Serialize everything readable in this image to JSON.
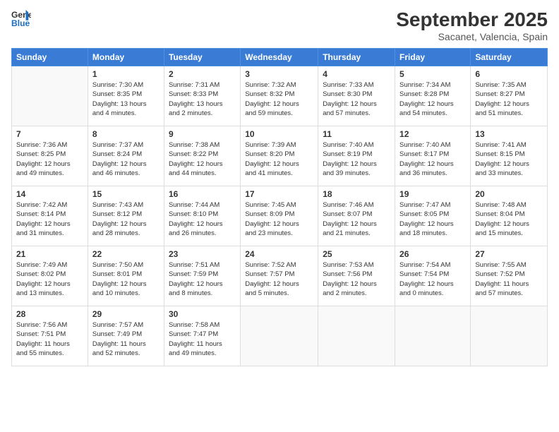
{
  "header": {
    "logo_line1": "General",
    "logo_line2": "Blue",
    "month": "September 2025",
    "location": "Sacanet, Valencia, Spain"
  },
  "days_of_week": [
    "Sunday",
    "Monday",
    "Tuesday",
    "Wednesday",
    "Thursday",
    "Friday",
    "Saturday"
  ],
  "weeks": [
    [
      {
        "num": "",
        "info": ""
      },
      {
        "num": "1",
        "info": "Sunrise: 7:30 AM\nSunset: 8:35 PM\nDaylight: 13 hours\nand 4 minutes."
      },
      {
        "num": "2",
        "info": "Sunrise: 7:31 AM\nSunset: 8:33 PM\nDaylight: 13 hours\nand 2 minutes."
      },
      {
        "num": "3",
        "info": "Sunrise: 7:32 AM\nSunset: 8:32 PM\nDaylight: 12 hours\nand 59 minutes."
      },
      {
        "num": "4",
        "info": "Sunrise: 7:33 AM\nSunset: 8:30 PM\nDaylight: 12 hours\nand 57 minutes."
      },
      {
        "num": "5",
        "info": "Sunrise: 7:34 AM\nSunset: 8:28 PM\nDaylight: 12 hours\nand 54 minutes."
      },
      {
        "num": "6",
        "info": "Sunrise: 7:35 AM\nSunset: 8:27 PM\nDaylight: 12 hours\nand 51 minutes."
      }
    ],
    [
      {
        "num": "7",
        "info": "Sunrise: 7:36 AM\nSunset: 8:25 PM\nDaylight: 12 hours\nand 49 minutes."
      },
      {
        "num": "8",
        "info": "Sunrise: 7:37 AM\nSunset: 8:24 PM\nDaylight: 12 hours\nand 46 minutes."
      },
      {
        "num": "9",
        "info": "Sunrise: 7:38 AM\nSunset: 8:22 PM\nDaylight: 12 hours\nand 44 minutes."
      },
      {
        "num": "10",
        "info": "Sunrise: 7:39 AM\nSunset: 8:20 PM\nDaylight: 12 hours\nand 41 minutes."
      },
      {
        "num": "11",
        "info": "Sunrise: 7:40 AM\nSunset: 8:19 PM\nDaylight: 12 hours\nand 39 minutes."
      },
      {
        "num": "12",
        "info": "Sunrise: 7:40 AM\nSunset: 8:17 PM\nDaylight: 12 hours\nand 36 minutes."
      },
      {
        "num": "13",
        "info": "Sunrise: 7:41 AM\nSunset: 8:15 PM\nDaylight: 12 hours\nand 33 minutes."
      }
    ],
    [
      {
        "num": "14",
        "info": "Sunrise: 7:42 AM\nSunset: 8:14 PM\nDaylight: 12 hours\nand 31 minutes."
      },
      {
        "num": "15",
        "info": "Sunrise: 7:43 AM\nSunset: 8:12 PM\nDaylight: 12 hours\nand 28 minutes."
      },
      {
        "num": "16",
        "info": "Sunrise: 7:44 AM\nSunset: 8:10 PM\nDaylight: 12 hours\nand 26 minutes."
      },
      {
        "num": "17",
        "info": "Sunrise: 7:45 AM\nSunset: 8:09 PM\nDaylight: 12 hours\nand 23 minutes."
      },
      {
        "num": "18",
        "info": "Sunrise: 7:46 AM\nSunset: 8:07 PM\nDaylight: 12 hours\nand 21 minutes."
      },
      {
        "num": "19",
        "info": "Sunrise: 7:47 AM\nSunset: 8:05 PM\nDaylight: 12 hours\nand 18 minutes."
      },
      {
        "num": "20",
        "info": "Sunrise: 7:48 AM\nSunset: 8:04 PM\nDaylight: 12 hours\nand 15 minutes."
      }
    ],
    [
      {
        "num": "21",
        "info": "Sunrise: 7:49 AM\nSunset: 8:02 PM\nDaylight: 12 hours\nand 13 minutes."
      },
      {
        "num": "22",
        "info": "Sunrise: 7:50 AM\nSunset: 8:01 PM\nDaylight: 12 hours\nand 10 minutes."
      },
      {
        "num": "23",
        "info": "Sunrise: 7:51 AM\nSunset: 7:59 PM\nDaylight: 12 hours\nand 8 minutes."
      },
      {
        "num": "24",
        "info": "Sunrise: 7:52 AM\nSunset: 7:57 PM\nDaylight: 12 hours\nand 5 minutes."
      },
      {
        "num": "25",
        "info": "Sunrise: 7:53 AM\nSunset: 7:56 PM\nDaylight: 12 hours\nand 2 minutes."
      },
      {
        "num": "26",
        "info": "Sunrise: 7:54 AM\nSunset: 7:54 PM\nDaylight: 12 hours\nand 0 minutes."
      },
      {
        "num": "27",
        "info": "Sunrise: 7:55 AM\nSunset: 7:52 PM\nDaylight: 11 hours\nand 57 minutes."
      }
    ],
    [
      {
        "num": "28",
        "info": "Sunrise: 7:56 AM\nSunset: 7:51 PM\nDaylight: 11 hours\nand 55 minutes."
      },
      {
        "num": "29",
        "info": "Sunrise: 7:57 AM\nSunset: 7:49 PM\nDaylight: 11 hours\nand 52 minutes."
      },
      {
        "num": "30",
        "info": "Sunrise: 7:58 AM\nSunset: 7:47 PM\nDaylight: 11 hours\nand 49 minutes."
      },
      {
        "num": "",
        "info": ""
      },
      {
        "num": "",
        "info": ""
      },
      {
        "num": "",
        "info": ""
      },
      {
        "num": "",
        "info": ""
      }
    ]
  ]
}
